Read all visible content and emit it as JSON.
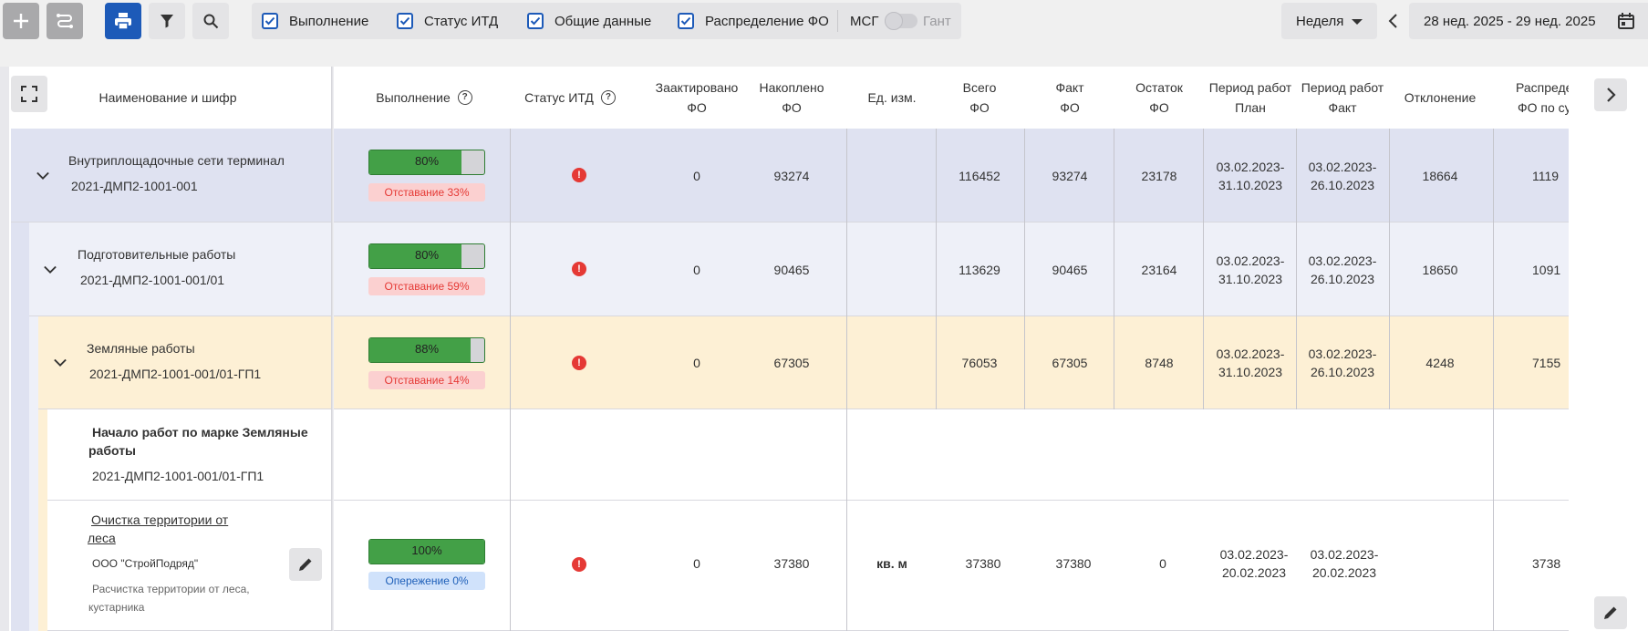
{
  "toolbar": {
    "filters": [
      {
        "label": "Выполнение",
        "checked": true
      },
      {
        "label": "Статус ИТД",
        "checked": true
      },
      {
        "label": "Общие данные",
        "checked": true
      },
      {
        "label": "Распределение ФО",
        "checked": true
      }
    ],
    "msg_label": "МСГ",
    "gant_label": "Гант",
    "week_select": "Неделя",
    "period": "28 нед. 2025 - 29 нед. 2025"
  },
  "columns": {
    "name": "Наименование и шифр",
    "vypolnenie": "Выполнение",
    "status_itd": "Статус ИТД",
    "zaaktirovano": [
      "Заактировано",
      "ФО"
    ],
    "nakopleno": [
      "Накоплено",
      "ФО"
    ],
    "ed_izm": "Ед. изм.",
    "vsego": [
      "Всего",
      "ФО"
    ],
    "fakt": [
      "Факт",
      "ФО"
    ],
    "ostatok": [
      "Остаток",
      "ФО"
    ],
    "period_plan": [
      "Период работ",
      "План"
    ],
    "period_fakt": [
      "Период работ",
      "Факт"
    ],
    "otklonenie": "Отклонение",
    "raspred": [
      "Распреде",
      "ФО по су"
    ]
  },
  "rows": [
    {
      "title": "Внутриплощадочные сети терминал",
      "code": "2021-ДМП2-1001-001",
      "progress": 80,
      "progress_label": "80%",
      "chip": "Отставание 33%",
      "zaakt": "0",
      "nakop": "93274",
      "ed": "",
      "vsego": "116452",
      "fakt": "93274",
      "ostatok": "23178",
      "plan": [
        "03.02.2023-",
        "31.10.2023"
      ],
      "factp": [
        "03.02.2023-",
        "26.10.2023"
      ],
      "otkl": "18664",
      "raspred": "1119"
    },
    {
      "title": "Подготовительные работы",
      "code": "2021-ДМП2-1001-001/01",
      "progress": 80,
      "progress_label": "80%",
      "chip": "Отставание 59%",
      "zaakt": "0",
      "nakop": "90465",
      "ed": "",
      "vsego": "113629",
      "fakt": "90465",
      "ostatok": "23164",
      "plan": [
        "03.02.2023-",
        "31.10.2023"
      ],
      "factp": [
        "03.02.2023-",
        "26.10.2023"
      ],
      "otkl": "18650",
      "raspred": "1091"
    },
    {
      "title": "Земляные работы",
      "code": "2021-ДМП2-1001-001/01-ГП1",
      "progress": 88,
      "progress_label": "88%",
      "chip": "Отставание 14%",
      "zaakt": "0",
      "nakop": "67305",
      "ed": "",
      "vsego": "76053",
      "fakt": "67305",
      "ostatok": "8748",
      "plan": [
        "03.02.2023-",
        "31.10.2023"
      ],
      "factp": [
        "03.02.2023-",
        "26.10.2023"
      ],
      "otkl": "4248",
      "raspred": "7155"
    }
  ],
  "marker_row": {
    "title_line1": "Начало работ по марке Земляные",
    "title_line2": "работы",
    "code": "2021-ДМП2-1001-001/01-ГП1"
  },
  "task_row": {
    "title_line1": "Очистка территории от",
    "title_line2": "леса",
    "contractor": "ООО \"СтройПодряд\"",
    "desc_line1": "Расчистка территории от леса,",
    "desc_line2": "кустарника",
    "progress": 100,
    "progress_label": "100%",
    "chip": "Опережение 0%",
    "zaakt": "0",
    "nakop": "37380",
    "ed": "кв. м",
    "vsego": "37380",
    "fakt": "37380",
    "ostatok": "0",
    "plan": [
      "03.02.2023-",
      "20.02.2023"
    ],
    "factp": [
      "03.02.2023-",
      "20.02.2023"
    ],
    "otkl": "",
    "raspred": "3738"
  },
  "colors": {
    "accent": "#1d5ab8",
    "progress_fill": "#43a047",
    "lag_text": "#e53935",
    "lag_bg": "#fbd0d0",
    "ahead_text": "#1e5fb8",
    "ahead_bg": "#d0e2fb",
    "row1_bg": "#dfe2f1",
    "row2_bg": "#eef0f8",
    "row3_bg": "#fdf0d5"
  },
  "icons": [
    "plus-icon",
    "route-icon",
    "print-icon",
    "filter-icon",
    "search-icon",
    "calendar-icon",
    "chevron-left-icon",
    "chevron-right-icon",
    "fullscreen-icon",
    "chevron-down-icon",
    "pencil-icon",
    "alert-icon",
    "help-icon"
  ]
}
